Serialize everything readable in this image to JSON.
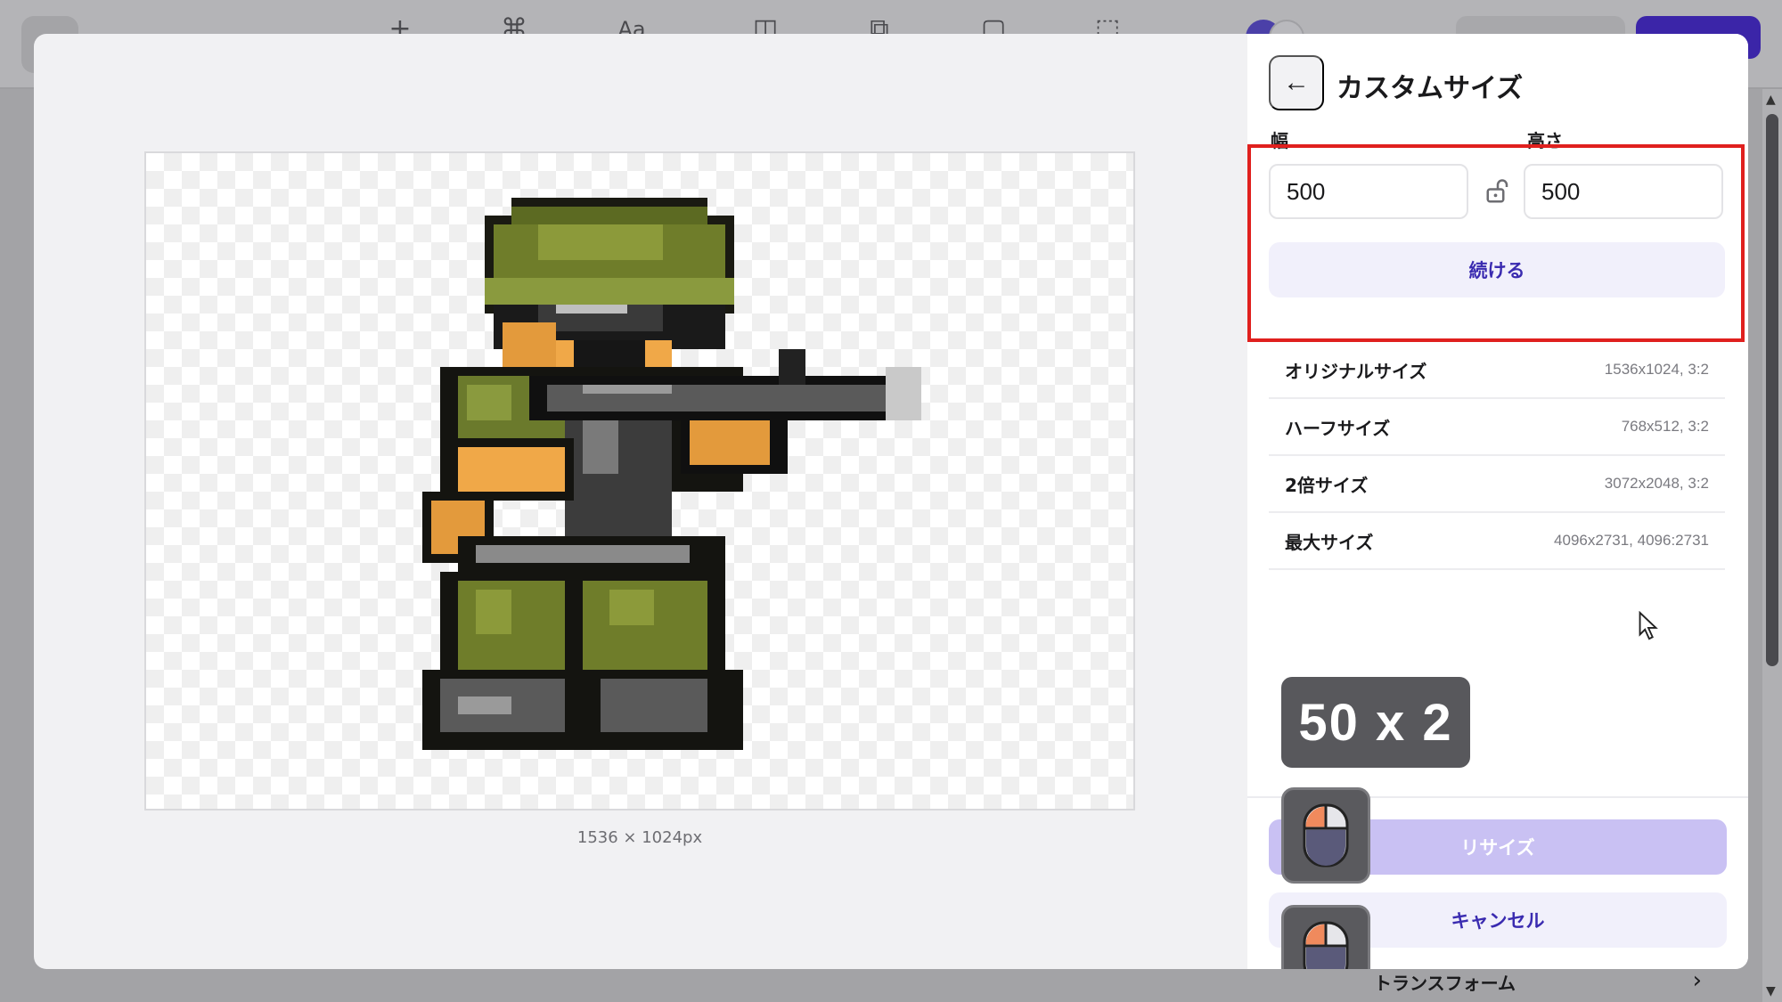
{
  "background": {
    "toolbar_icons": [
      "plus-icon",
      "brush-icon",
      "text-size-icon",
      "shape-icon",
      "image-layers-icon",
      "sticker-icon",
      "crop-select-icon"
    ],
    "toolbar_glyphs": [
      "+",
      "⌘",
      "Aa",
      "◫",
      "⧉",
      "▢",
      "⬚"
    ]
  },
  "preview": {
    "dimensions_caption": "1536 × 1024px"
  },
  "panel": {
    "title": "カスタムサイズ",
    "width_label": "幅",
    "height_label": "高さ",
    "width_value": "500",
    "height_value": "500",
    "continue_label": "続ける",
    "presets": [
      {
        "name": "オリジナルサイズ",
        "value": "1536x1024, 3:2"
      },
      {
        "name": "ハーフサイズ",
        "value": "768x512, 3:2"
      },
      {
        "name": "2倍サイズ",
        "value": "3072x2048, 3:2"
      },
      {
        "name": "最大サイズ",
        "value": "4096x2731, 4096:2731"
      }
    ],
    "keycap_overlay": "50 x 2",
    "resize_label": "リサイズ",
    "cancel_label": "キャンセル",
    "transform_label": "トランスフォーム"
  },
  "colors": {
    "accent": "#3a2bb0",
    "accent_soft": "#f1f0fb",
    "disabled_button": "#c9c1f3",
    "highlight": "#e0201e"
  }
}
